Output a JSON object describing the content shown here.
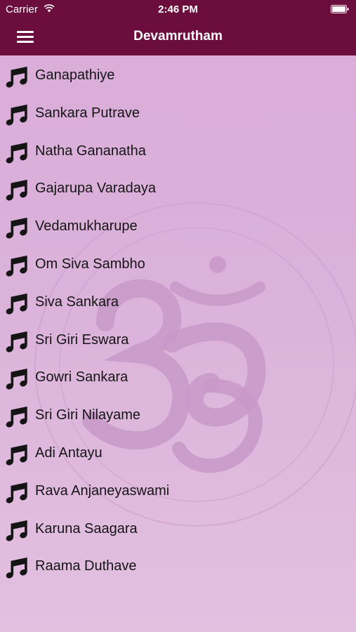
{
  "status_bar": {
    "carrier": "Carrier",
    "time": "2:46 PM"
  },
  "nav": {
    "title": "Devamrutham",
    "menu_icon": "hamburger-menu-icon"
  },
  "colors": {
    "header": "#6b0d3d",
    "background": "#dbb2da",
    "text": "#151515"
  },
  "list_icon": "music-note-icon",
  "songs": [
    {
      "title": "Ganapathiye"
    },
    {
      "title": "Sankara Putrave"
    },
    {
      "title": "Natha Gananatha"
    },
    {
      "title": "Gajarupa Varadaya"
    },
    {
      "title": "Vedamukharupe"
    },
    {
      "title": "Om Siva Sambho"
    },
    {
      "title": "Siva Sankara"
    },
    {
      "title": "Sri Giri Eswara"
    },
    {
      "title": "Gowri Sankara"
    },
    {
      "title": "Sri Giri Nilayame"
    },
    {
      "title": "Adi Antayu"
    },
    {
      "title": "Rava Anjaneyaswami"
    },
    {
      "title": "Karuna Saagara"
    },
    {
      "title": "Raama Duthave"
    }
  ]
}
